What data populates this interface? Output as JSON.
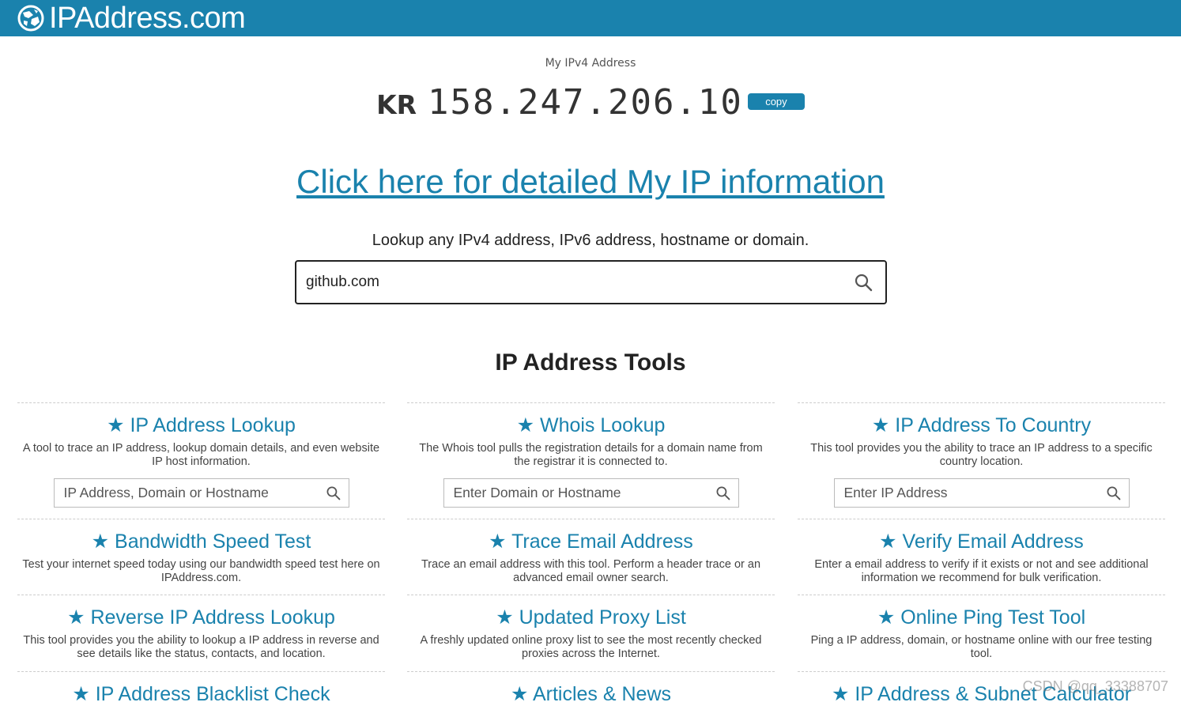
{
  "header": {
    "brand": "IPAddress.com",
    "logo_icon": "globe-icon",
    "color": "#1a82ad"
  },
  "myip": {
    "label": "My IPv4 Address",
    "country_code": "KR",
    "ip": "158.247.206.10",
    "copy_label": "copy"
  },
  "detail_link": "Click here for detailed My IP information",
  "lookup": {
    "prompt": "Lookup any IPv4 address, IPv6 address, hostname or domain.",
    "value": "github.com",
    "icon": "search-icon"
  },
  "tools_title": "IP Address Tools",
  "tools": [
    {
      "title": "IP Address Lookup",
      "desc": "A tool to trace an IP address, lookup domain details, and even website IP host information.",
      "placeholder": "IP Address, Domain or Hostname"
    },
    {
      "title": "Whois Lookup",
      "desc": "The Whois tool pulls the registration details for a domain name from the registrar it is connected to.",
      "placeholder": "Enter Domain or Hostname"
    },
    {
      "title": "IP Address To Country",
      "desc": "This tool provides you the ability to trace an IP address to a specific country location.",
      "placeholder": "Enter IP Address"
    },
    {
      "title": "Bandwidth Speed Test",
      "desc": "Test your internet speed today using our bandwidth speed test here on IPAddress.com."
    },
    {
      "title": "Trace Email Address",
      "desc": "Trace an email address with this tool. Perform a header trace or an advanced email owner search."
    },
    {
      "title": "Verify Email Address",
      "desc": "Enter a email address to verify if it exists or not and see additional information we recommend for bulk verification."
    },
    {
      "title": "Reverse IP Address Lookup",
      "desc": "This tool provides you the ability to lookup a IP address in reverse and see details like the status, contacts, and location."
    },
    {
      "title": "Updated Proxy List",
      "desc": "A freshly updated online proxy list to see the most recently checked proxies across the Internet."
    },
    {
      "title": "Online Ping Test Tool",
      "desc": "Ping a IP address, domain, or hostname online with our free testing tool."
    },
    {
      "title": "IP Address Blacklist Check"
    },
    {
      "title": "Articles & News"
    },
    {
      "title": "IP Address & Subnet Calculator"
    }
  ],
  "star": "★",
  "watermark": "CSDN @qq_33388707"
}
